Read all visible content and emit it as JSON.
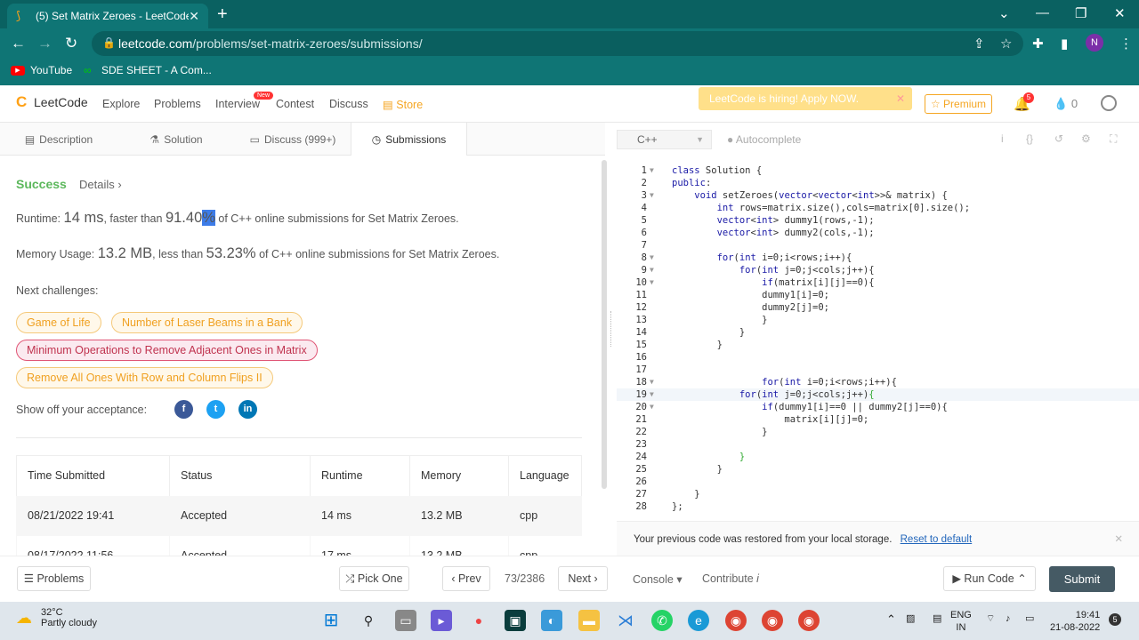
{
  "browser": {
    "tab_title": "(5) Set Matrix Zeroes - LeetCode",
    "url_host": "leetcode.com",
    "url_path": "/problems/set-matrix-zeroes/submissions/",
    "profile_initial": "N",
    "bookmarks": [
      "YouTube",
      "SDE SHEET - A Com..."
    ]
  },
  "header": {
    "logo": "LeetCode",
    "nav": [
      "Explore",
      "Problems",
      "Interview",
      "Contest",
      "Discuss",
      "Store"
    ],
    "new_badge": "New",
    "hiring": "LeetCode is hiring! Apply NOW.",
    "premium": "Premium",
    "notif_count": "5",
    "streak": "0"
  },
  "left_tabs": [
    "Description",
    "Solution",
    "Discuss (999+)",
    "Submissions"
  ],
  "result": {
    "status": "Success",
    "details": "Details",
    "runtime_label": "Runtime:",
    "runtime_value": "14 ms",
    "runtime_mid": ", faster than",
    "runtime_pct_num": "91.40",
    "runtime_pct_sign": "%",
    "runtime_tail": "of C++ online submissions for Set Matrix Zeroes.",
    "memory_label": "Memory Usage:",
    "memory_value": "13.2 MB",
    "memory_mid": ", less than",
    "memory_pct": "53.23%",
    "memory_tail": "of C++ online submissions for Set Matrix Zeroes.",
    "next_label": "Next challenges:",
    "challenges": [
      "Game of Life",
      "Number of Laser Beams in a Bank",
      "Minimum Operations to Remove Adjacent Ones in Matrix",
      "Remove All Ones With Row and Column Flips II"
    ],
    "show_off": "Show off your acceptance:"
  },
  "submissions": {
    "columns": [
      "Time Submitted",
      "Status",
      "Runtime",
      "Memory",
      "Language"
    ],
    "rows": [
      [
        "08/21/2022 19:41",
        "Accepted",
        "14 ms",
        "13.2 MB",
        "cpp"
      ],
      [
        "08/17/2022 11:56",
        "Accepted",
        "17 ms",
        "13.2 MB",
        "cpp"
      ]
    ]
  },
  "bottom": {
    "problems": "Problems",
    "pick_one": "Pick One",
    "prev": "Prev",
    "pager": "73/2386",
    "next": "Next",
    "console": "Console",
    "contribute": "Contribute",
    "run_code": "Run Code",
    "submit": "Submit"
  },
  "editor": {
    "language": "C++",
    "autocomplete": "Autocomplete",
    "restore_msg": "Your previous code was restored from your local storage.",
    "reset_link": "Reset to default"
  },
  "taskbar": {
    "temp": "32°C",
    "weather": "Partly cloudy",
    "lang1": "ENG",
    "lang2": "IN",
    "time": "19:41",
    "date": "21-08-2022",
    "notif": "5"
  }
}
